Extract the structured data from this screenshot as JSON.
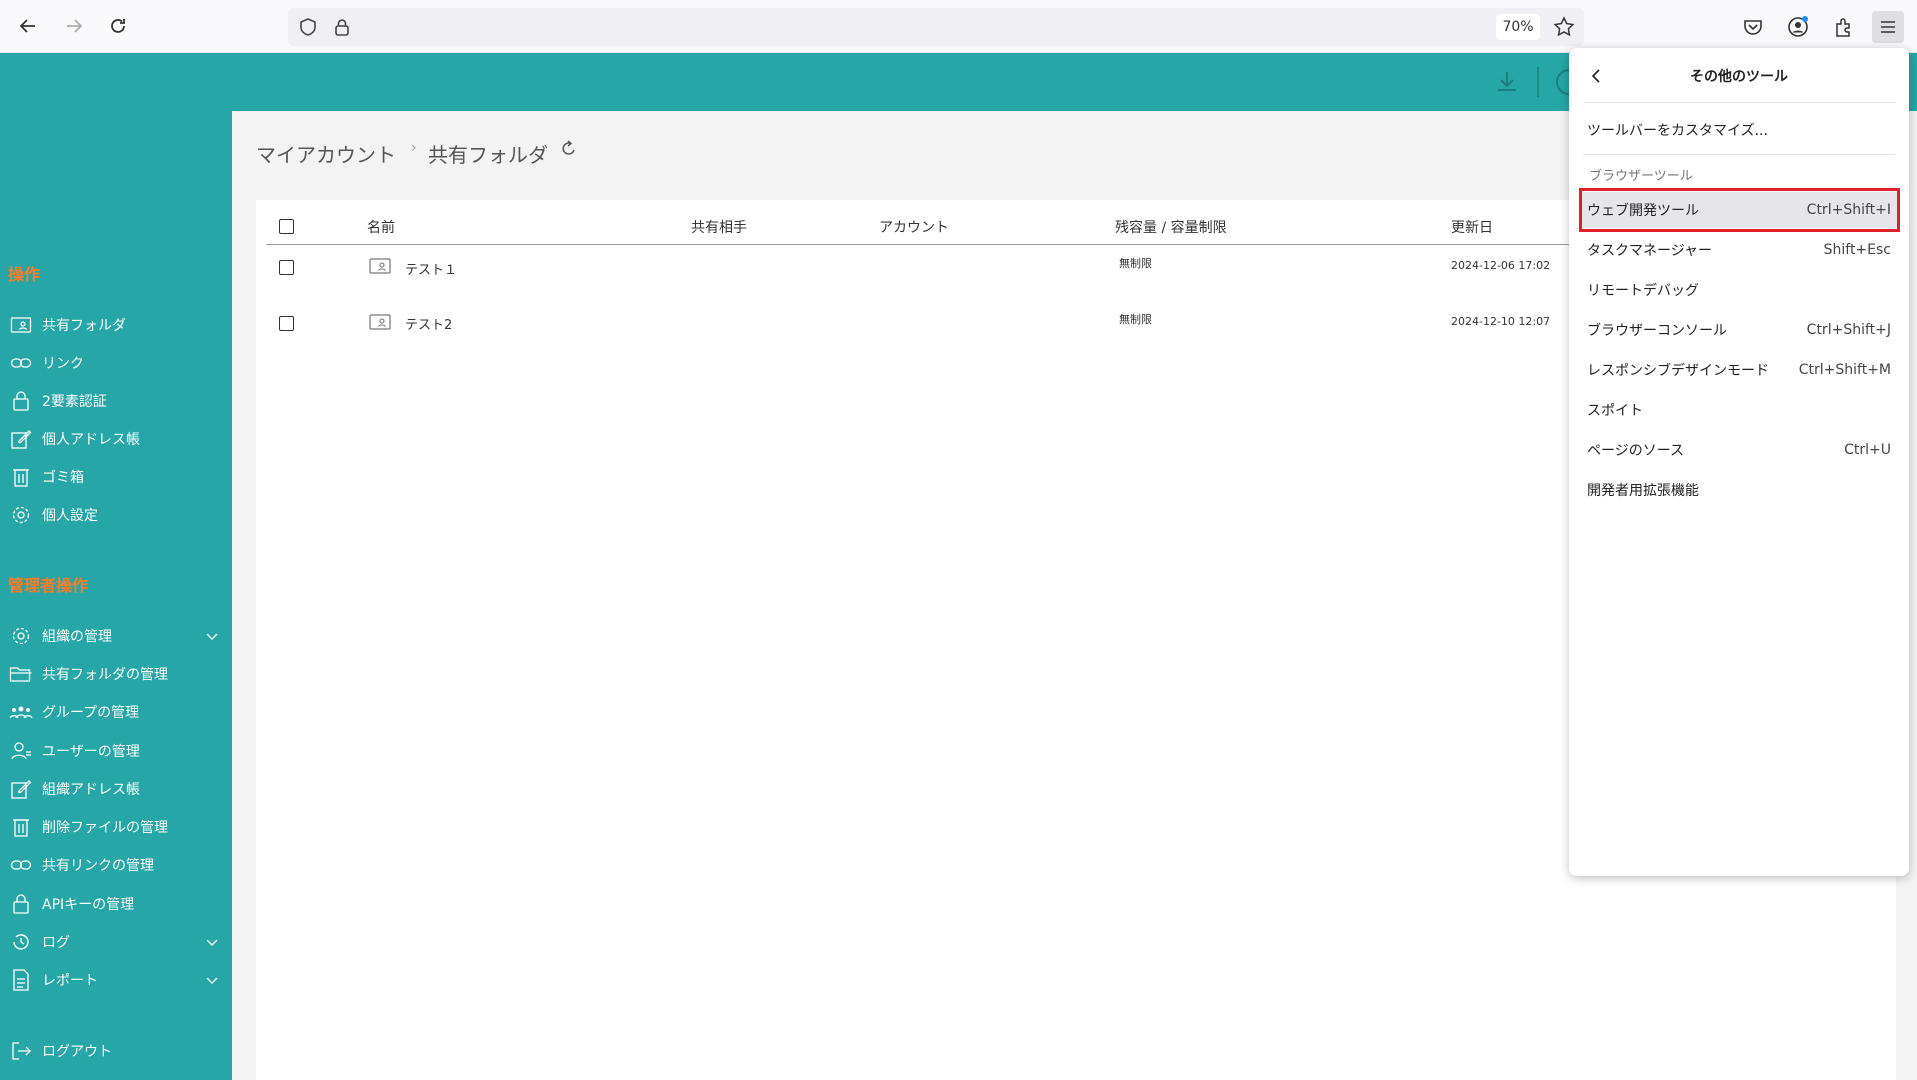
{
  "browser": {
    "zoom": "70%"
  },
  "sidebar": {
    "section_ops": "操作",
    "ops_items": [
      {
        "label": "共有フォルダ",
        "icon": "shared-folder-icon"
      },
      {
        "label": "リンク",
        "icon": "link-icon"
      },
      {
        "label": "2要素認証",
        "icon": "lock-icon"
      },
      {
        "label": "個人アドレス帳",
        "icon": "edit-icon"
      },
      {
        "label": "ゴミ箱",
        "icon": "trash-icon"
      },
      {
        "label": "個人設定",
        "icon": "gear-icon"
      }
    ],
    "section_admin": "管理者操作",
    "admin_items": [
      {
        "label": "組織の管理",
        "icon": "gear-icon",
        "expandable": true
      },
      {
        "label": "共有フォルダの管理",
        "icon": "folder-open-icon"
      },
      {
        "label": "グループの管理",
        "icon": "group-icon"
      },
      {
        "label": "ユーザーの管理",
        "icon": "user-icon"
      },
      {
        "label": "組織アドレス帳",
        "icon": "edit-icon"
      },
      {
        "label": "削除ファイルの管理",
        "icon": "trash-icon"
      },
      {
        "label": "共有リンクの管理",
        "icon": "link-icon"
      },
      {
        "label": "APIキーの管理",
        "icon": "lock-icon"
      },
      {
        "label": "ログ",
        "icon": "history-icon",
        "expandable": true
      },
      {
        "label": "レポート",
        "icon": "report-icon",
        "expandable": true
      }
    ],
    "logout": "ログアウト"
  },
  "breadcrumb": {
    "root": "マイアカウント",
    "separator": "›",
    "current": "共有フォルダ"
  },
  "table": {
    "columns": [
      "名前",
      "共有相手",
      "アカウント",
      "残容量 / 容量制限",
      "更新日"
    ],
    "rows": [
      {
        "name": "テスト１",
        "shared_with": "",
        "account": "",
        "capacity": "無制限",
        "updated": "2024-12-06 17:02"
      },
      {
        "name": "テスト2",
        "shared_with": "",
        "account": "",
        "capacity": "無制限",
        "updated": "2024-12-10 12:07"
      }
    ]
  },
  "menu": {
    "title": "その他のツール",
    "customize": "ツールバーをカスタマイズ...",
    "section_label": "ブラウザーツール",
    "items": [
      {
        "label": "ウェブ開発ツール",
        "shortcut": "Ctrl+Shift+I"
      },
      {
        "label": "タスクマネージャー",
        "shortcut": "Shift+Esc"
      },
      {
        "label": "リモートデバッグ",
        "shortcut": ""
      },
      {
        "label": "ブラウザーコンソール",
        "shortcut": "Ctrl+Shift+J"
      },
      {
        "label": "レスポンシブデザインモード",
        "shortcut": "Ctrl+Shift+M"
      },
      {
        "label": "スポイト",
        "shortcut": ""
      },
      {
        "label": "ページのソース",
        "shortcut": "Ctrl+U"
      },
      {
        "label": "開発者用拡張機能",
        "shortcut": ""
      }
    ]
  },
  "colors": {
    "teal": "#26a6a7",
    "orange": "#ff7a22",
    "highlight_red": "#e3202a"
  }
}
